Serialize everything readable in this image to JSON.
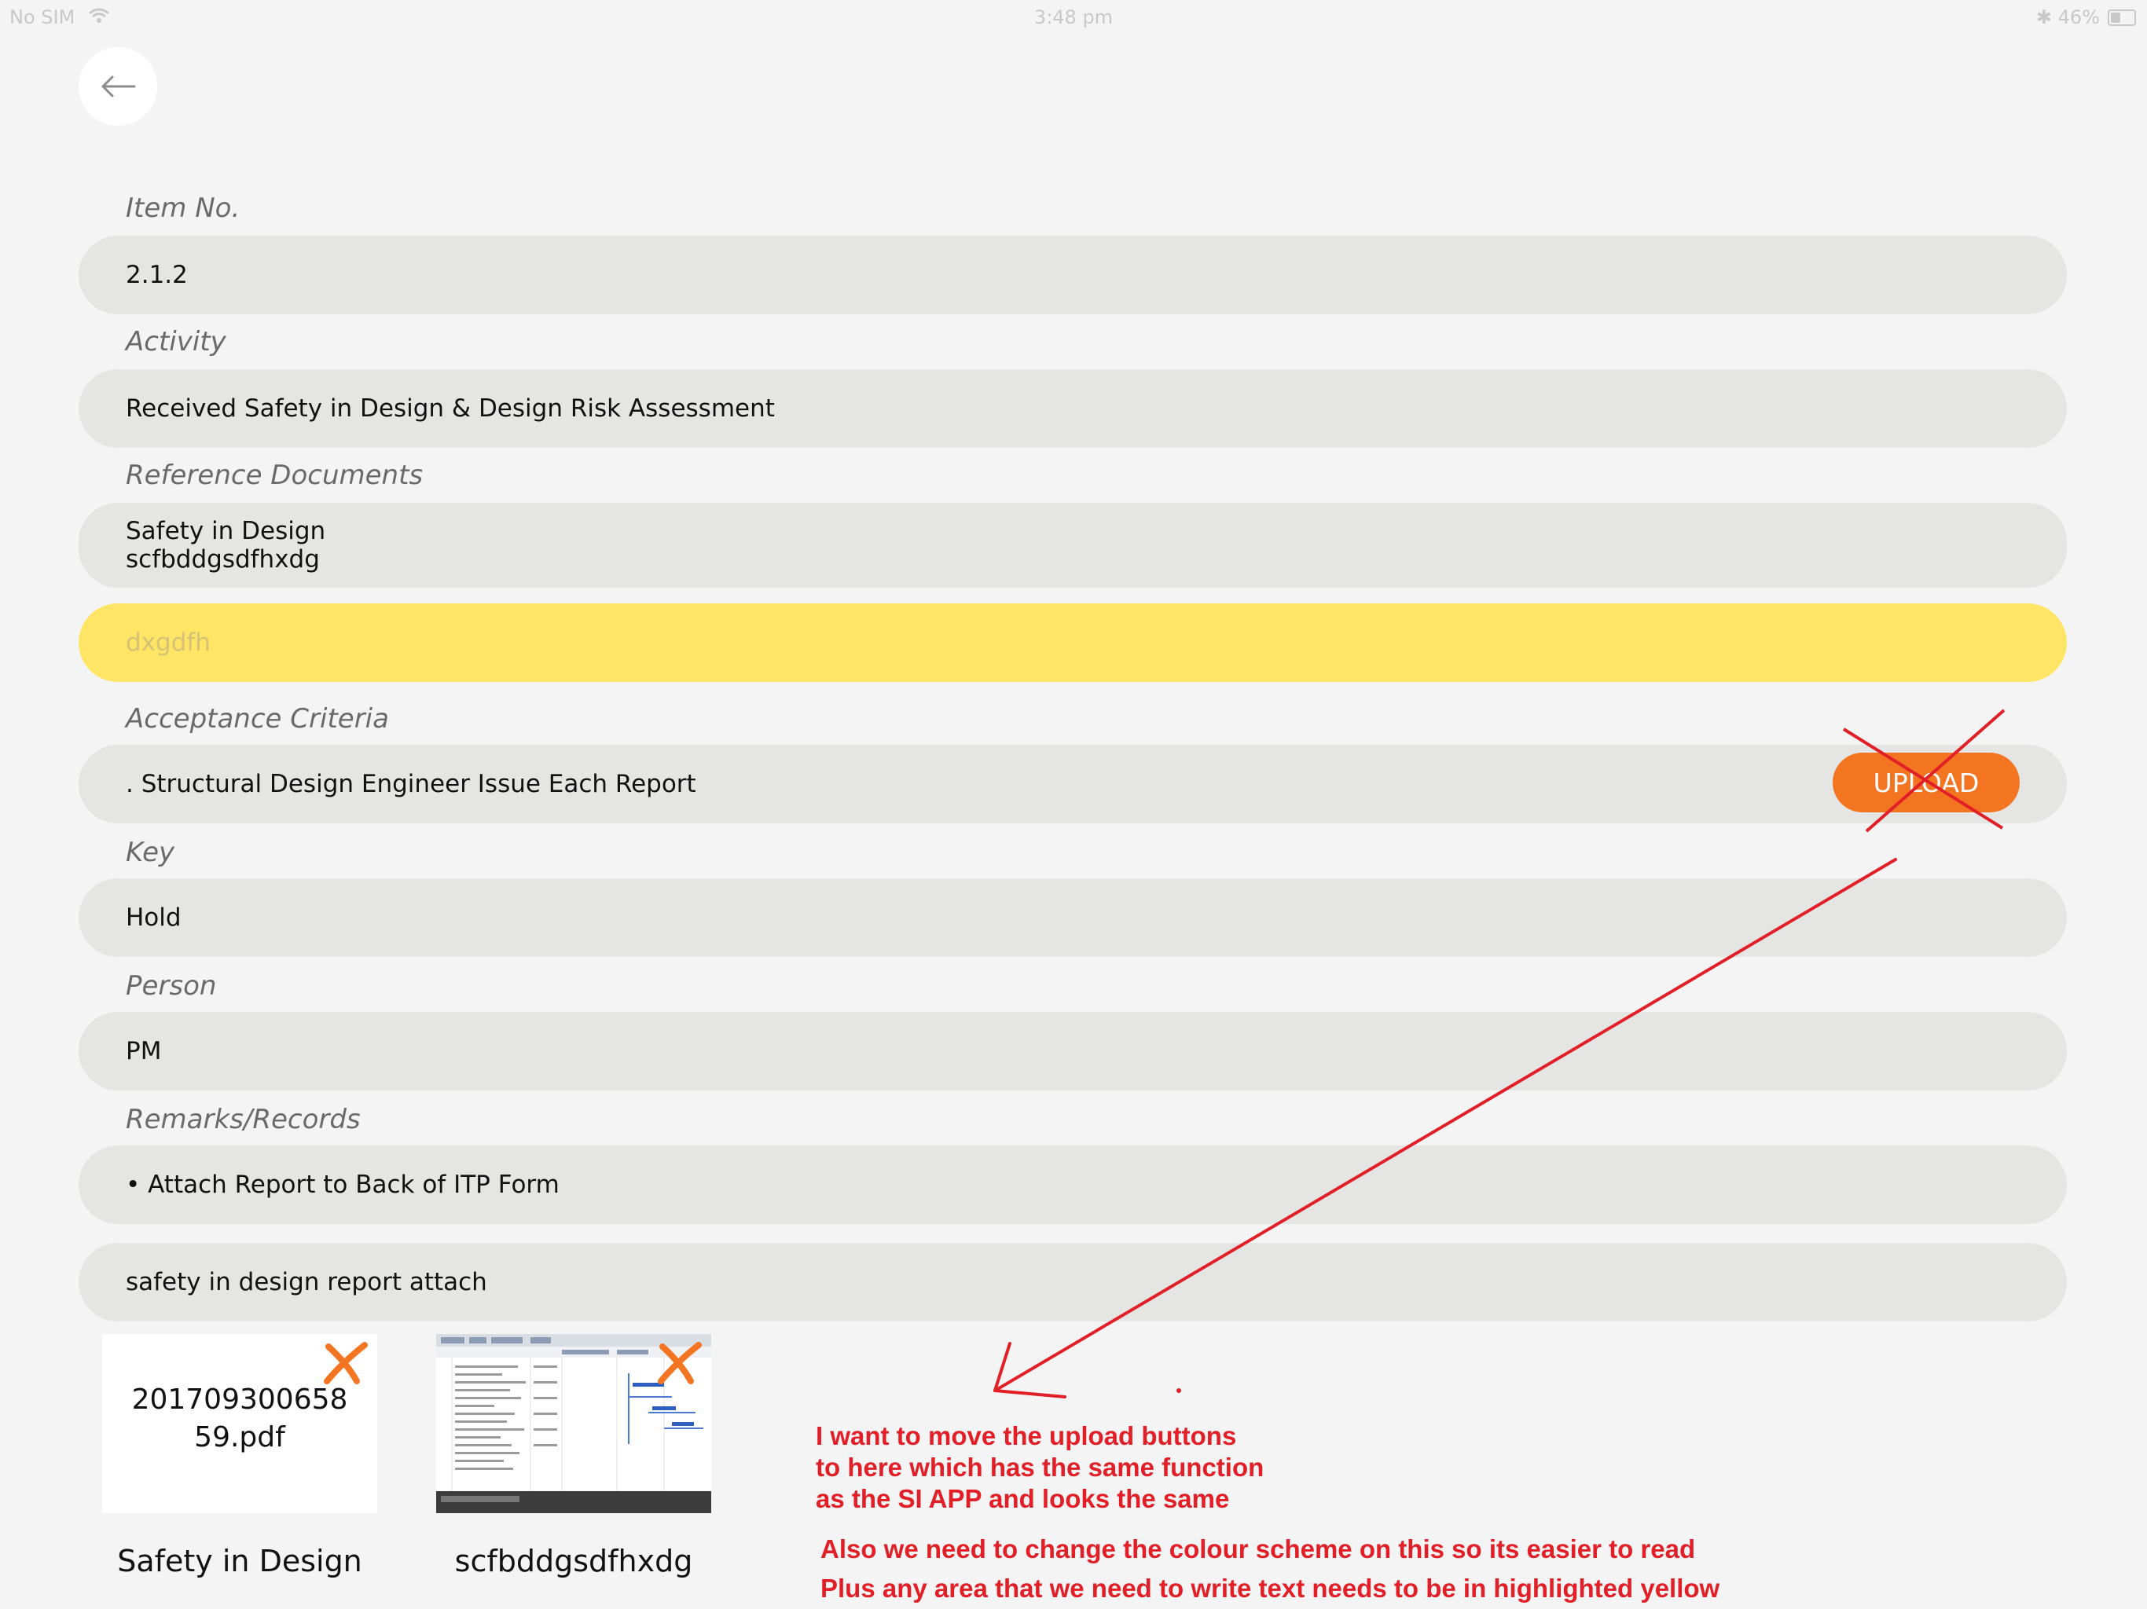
{
  "status_bar": {
    "carrier": "No SIM",
    "time": "3:48 pm",
    "battery": "46%"
  },
  "fields": [
    {
      "label": "Item No.",
      "value": "2.1.2"
    },
    {
      "label": "Activity",
      "value": "Received Safety in Design & Design Risk Assessment"
    },
    {
      "label": "Reference Documents",
      "lines": [
        "Safety in Design",
        "scfbddgsdfhxdg"
      ]
    },
    {
      "placeholder": "dxgdfh",
      "highlight_color": "#fee566"
    },
    {
      "label": "Acceptance Criteria",
      "value": ". Structural Design Engineer Issue Each Report"
    },
    {
      "label": "Key",
      "value": "Hold"
    },
    {
      "label": "Person",
      "value": "PM"
    },
    {
      "label": "Remarks/Records",
      "value": "• Attach Report to Back of ITP Form"
    },
    {
      "value": "safety in design report attach"
    }
  ],
  "upload_button": {
    "label": "UPLOAD",
    "color": "#f47521"
  },
  "attachments": [
    {
      "thumb_text": "20170930065859.pdf",
      "caption": "Safety in Design",
      "type": "pdf"
    },
    {
      "caption": "scfbddgsdfhxdg",
      "type": "screenshot"
    }
  ],
  "annotations": {
    "color": "#e21f26",
    "note1": [
      "I want to move the upload buttons",
      "to here which has the same function",
      "as the SI APP and looks the same"
    ],
    "note2": [
      "Also we need to change the colour scheme on this so its easier to read",
      "Plus any area that we need to write text needs to be in highlighted yellow"
    ]
  }
}
